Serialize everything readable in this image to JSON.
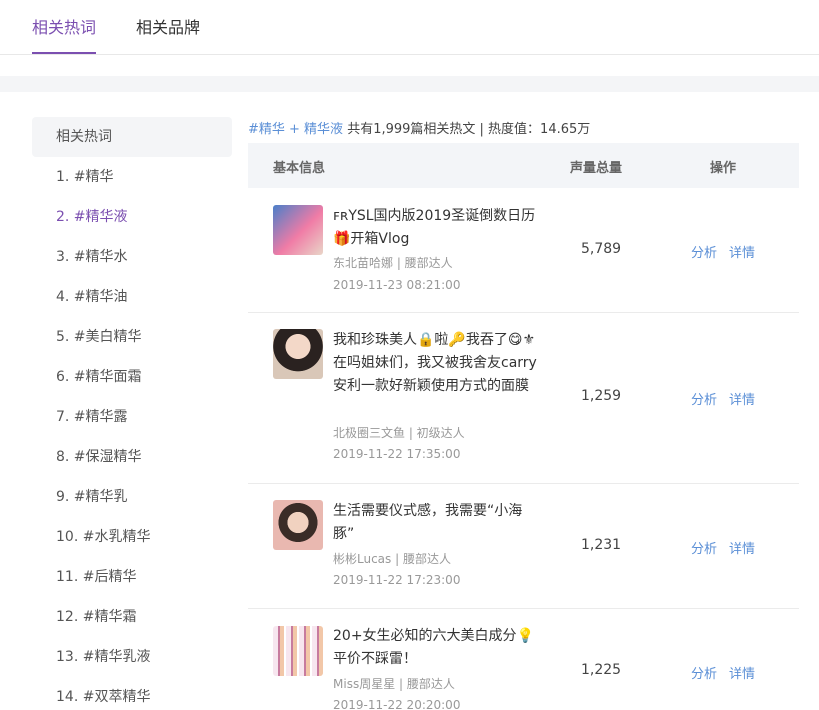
{
  "tabs": [
    {
      "label": "相关热词",
      "active": true
    },
    {
      "label": "相关品牌",
      "active": false
    }
  ],
  "sidebar": {
    "header": "相关热词",
    "items": [
      {
        "label": "1. #精华"
      },
      {
        "label": "2. #精华液",
        "active": true
      },
      {
        "label": "3. #精华水"
      },
      {
        "label": "4. #精华油"
      },
      {
        "label": "5. #美白精华"
      },
      {
        "label": "6. #精华面霜"
      },
      {
        "label": "7. #精华露"
      },
      {
        "label": "8. #保湿精华"
      },
      {
        "label": "9. #精华乳"
      },
      {
        "label": "10. #水乳精华"
      },
      {
        "label": "11. #后精华"
      },
      {
        "label": "12. #精华霜"
      },
      {
        "label": "13. #精华乳液"
      },
      {
        "label": "14. #双萃精华"
      }
    ]
  },
  "summary": {
    "tag_text": "#精华 + 精华液",
    "rest_text": " 共有1,999篇相关热文 | 热度值：14.65万"
  },
  "table": {
    "headers": {
      "info": "基本信息",
      "volume": "声量总量",
      "action": "操作"
    },
    "analyze_label": "分析",
    "detail_label": "详情",
    "rows": [
      {
        "title": "ꜰʀYSL国内版2019圣诞倒数日历🎁开箱Vlog",
        "author": "东北苗哈娜 | 腰部达人",
        "date": "2019-11-23 08:21:00",
        "volume": "5,789",
        "thumb_icon": "video-thumbnail-icon"
      },
      {
        "title": "我和珍珠美人🔒啦🔑我吞了😋⚜在吗姐妹们，我又被我舍友carry安利一款好新颖使用方式的面膜",
        "author": "北极圈三文鱼 | 初级达人",
        "date": "2019-11-22 17:35:00",
        "volume": "1,259",
        "thumb_icon": "portrait-thumbnail-icon"
      },
      {
        "title": "生活需要仪式感，我需要“小海豚”",
        "author": "彬彬Lucas | 腰部达人",
        "date": "2019-11-22 17:23:00",
        "volume": "1,231",
        "thumb_icon": "portrait-thumbnail-icon"
      },
      {
        "title": "20+女生必知的六大美白成分💡平价不踩雷！",
        "author": "Miss周星星 | 腰部达人",
        "date": "2019-11-22 20:20:00",
        "volume": "1,225",
        "thumb_icon": "products-thumbnail-icon"
      }
    ]
  },
  "colors": {
    "accent": "#7b4fb0",
    "link": "#5b8fd6",
    "muted": "#999999",
    "header_bg": "#f3f5f8"
  }
}
